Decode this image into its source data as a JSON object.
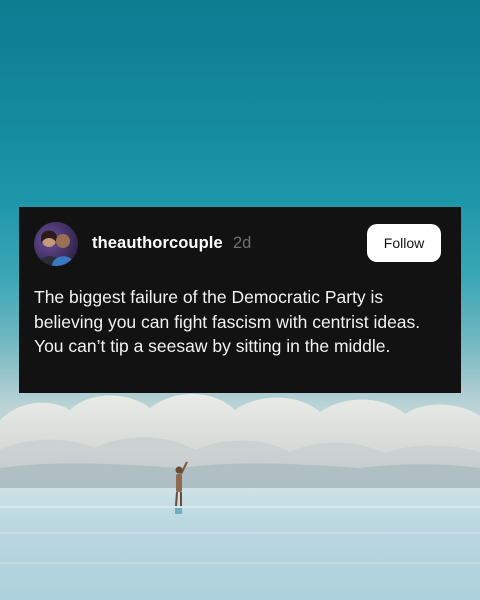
{
  "post": {
    "username": "theauthorcouple",
    "time_ago": "2d",
    "follow_label": "Follow",
    "text": "The biggest failure of the Democratic Party is believing you can fight fascism with centrist ideas. You can’t tip a seesaw by sitting in the middle."
  },
  "background": {
    "sky_color": "#0d7d92",
    "card_color": "#121212"
  }
}
